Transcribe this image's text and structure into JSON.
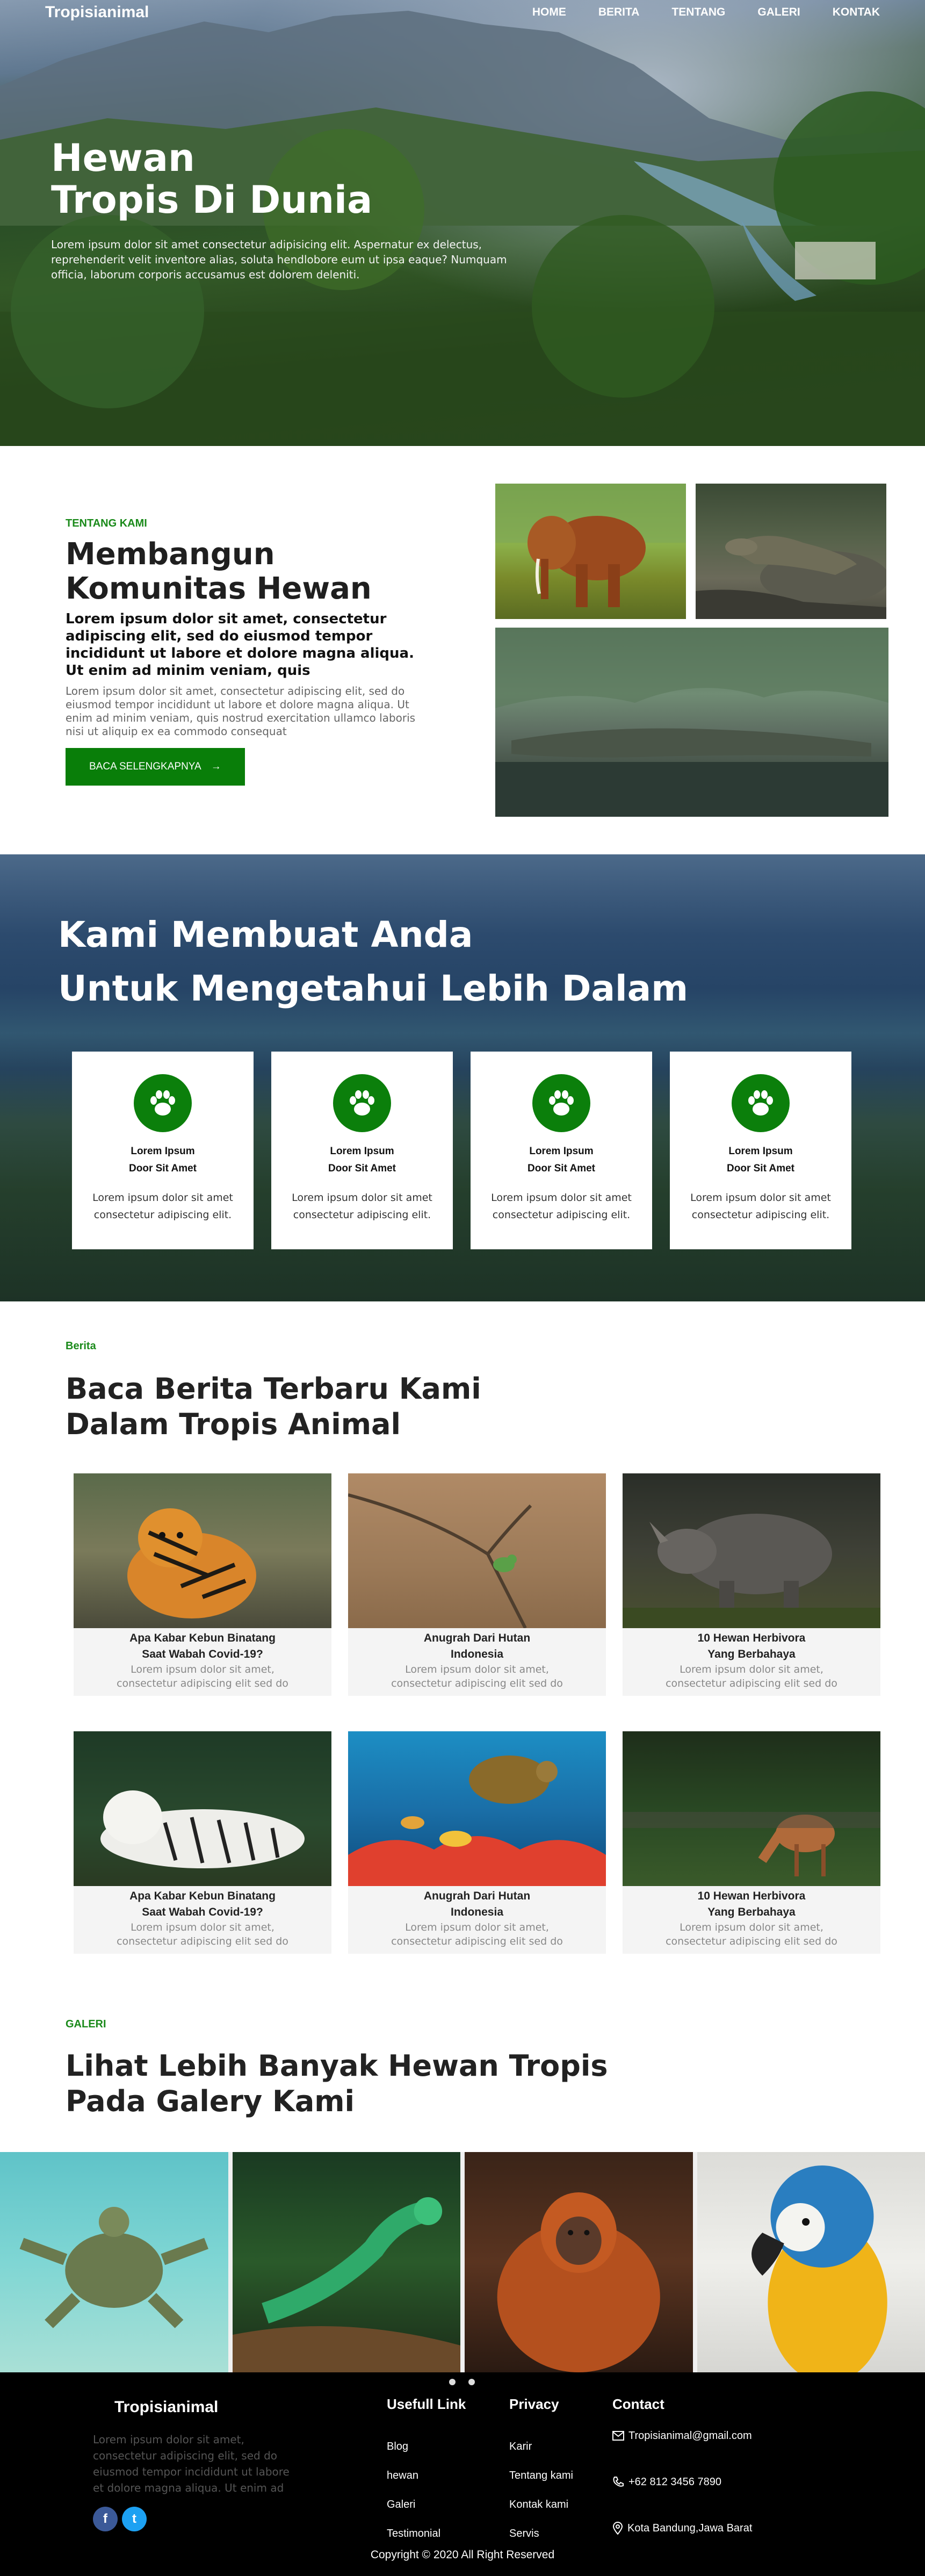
{
  "nav": {
    "brand": "Tropisianimal",
    "links": [
      "HOME",
      "BERITA",
      "TENTANG",
      "GALERI",
      "KONTAK"
    ]
  },
  "hero": {
    "title_line1": "Hewan",
    "title_line2": "Tropis Di Dunia",
    "description": "Lorem ipsum dolor sit amet consectetur adipisicing elit. Aspernatur ex delectus, reprehenderit velit inventore alias, soluta hendlobore eum ut ipsa eaque? Numquam officia, laborum corporis accusamus est dolorem deleniti."
  },
  "about": {
    "eyebrow": "TENTANG KAMI",
    "title_line1": "Membangun",
    "title_line2": "Komunitas Hewan",
    "lead": "Lorem ipsum dolor sit amet, consectetur adipiscing elit, sed do eiusmod tempor incididunt ut labore et dolore magna aliqua. Ut enim ad minim veniam, quis",
    "body": "Lorem ipsum dolor sit amet, consectetur adipiscing elit, sed do eiusmod tempor incididunt ut labore et dolore magna aliqua. Ut enim ad minim veniam, quis nostrud exercitation ullamco laboris nisi ut aliquip ex ea commodo consequat",
    "button": "BACA SELENGKAPNYA"
  },
  "know": {
    "title_line1": "Kami Membuat Anda",
    "title_line2": "Untuk Mengetahui Lebih Dalam",
    "features": [
      {
        "title1": "Lorem Ipsum",
        "title2": "Door Sit Amet",
        "desc": "Lorem ipsum dolor sit amet consectetur adipiscing elit."
      },
      {
        "title1": "Lorem Ipsum",
        "title2": "Door Sit Amet",
        "desc": "Lorem ipsum dolor sit amet consectetur adipiscing elit."
      },
      {
        "title1": "Lorem Ipsum",
        "title2": "Door Sit Amet",
        "desc": "Lorem ipsum dolor sit amet consectetur adipiscing elit."
      },
      {
        "title1": "Lorem Ipsum",
        "title2": "Door Sit Amet",
        "desc": "Lorem ipsum dolor sit amet consectetur adipiscing elit."
      }
    ],
    "icon": "paw-icon"
  },
  "news": {
    "eyebrow": "Berita",
    "title_line1": "Baca Berita Terbaru Kami",
    "title_line2": "Dalam Tropis Animal",
    "cards": [
      {
        "title1": "Apa Kabar Kebun Binatang",
        "title2": "Saat Wabah Covid-19?",
        "desc1": "Lorem ipsum dolor sit amet,",
        "desc2": "consectetur adipiscing elit sed do",
        "image": "tiger"
      },
      {
        "title1": "Anugrah Dari Hutan",
        "title2": "Indonesia",
        "desc1": "Lorem ipsum dolor sit amet,",
        "desc2": "consectetur adipiscing elit sed do",
        "image": "bird"
      },
      {
        "title1": "10 Hewan Herbivora",
        "title2": "Yang Berbahaya",
        "desc1": "Lorem ipsum dolor sit amet,",
        "desc2": "consectetur adipiscing elit sed do",
        "image": "rhino"
      },
      {
        "title1": "Apa Kabar Kebun Binatang",
        "title2": "Saat Wabah Covid-19?",
        "desc1": "Lorem ipsum dolor sit amet,",
        "desc2": "consectetur adipiscing elit sed do",
        "image": "white-tiger"
      },
      {
        "title1": "Anugrah Dari Hutan",
        "title2": "Indonesia",
        "desc1": "Lorem ipsum dolor sit amet,",
        "desc2": "consectetur adipiscing elit sed do",
        "image": "sea-turtle"
      },
      {
        "title1": "10 Hewan Herbivora",
        "title2": "Yang Berbahaya",
        "desc1": "Lorem ipsum dolor sit amet,",
        "desc2": "consectetur adipiscing elit sed do",
        "image": "deer"
      }
    ]
  },
  "gallery": {
    "eyebrow": "GALERI",
    "title_line1": "Lihat Lebih Banyak Hewan Tropis",
    "title_line2": "Pada Galery Kami",
    "images": [
      "turtle",
      "lizard",
      "orangutan",
      "macaw"
    ]
  },
  "footer": {
    "brand": "Tropisianimal",
    "about": "Lorem ipsum dolor sit amet, consectetur adipiscing elit, sed do eiusmod tempor incididunt ut labore et dolore magna aliqua. Ut enim ad",
    "useful_title": "Usefull Link",
    "useful_links": [
      "Blog",
      "hewan",
      "Galeri",
      "Testimonial"
    ],
    "privacy_title": "Privacy",
    "privacy_links": [
      "Karir",
      "Tentang kami",
      "Kontak kami",
      "Servis"
    ],
    "contact_title": "Contact",
    "email": "Tropisianimal@gmail.com",
    "phone": "+62 812 3456 7890",
    "address": "Kota Bandung,Jawa Barat",
    "copyright": "Copyright © 2020 All Right Reserved",
    "social": [
      "f",
      "t"
    ],
    "colors": {
      "facebook": "#3b5998",
      "twitter": "#1da1f2",
      "accent": "#097e09"
    }
  }
}
